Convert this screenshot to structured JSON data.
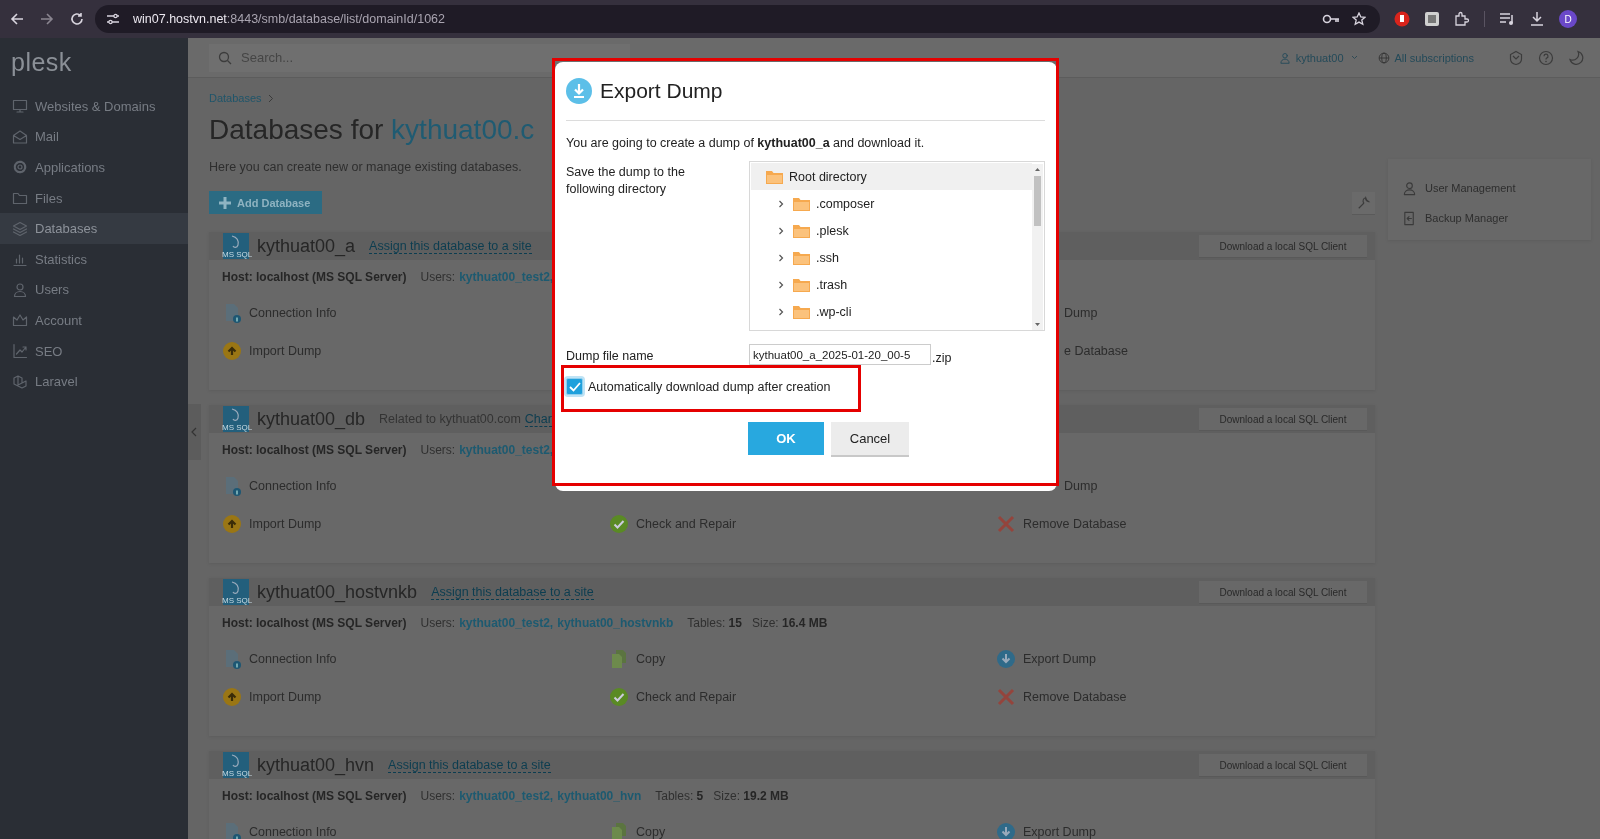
{
  "browser": {
    "url_host": "win07.hostvn.net",
    "url_path": ":8443/smb/database/list/domainId/1062",
    "profile_initial": "D"
  },
  "sidebar": {
    "logo": "plesk",
    "items": [
      {
        "label": "Websites & Domains",
        "selected": false
      },
      {
        "label": "Mail",
        "selected": false
      },
      {
        "label": "Applications",
        "selected": false
      },
      {
        "label": "Files",
        "selected": false
      },
      {
        "label": "Databases",
        "selected": true
      },
      {
        "label": "Statistics",
        "selected": false
      },
      {
        "label": "Users",
        "selected": false
      },
      {
        "label": "Account",
        "selected": false
      },
      {
        "label": "SEO",
        "selected": false
      },
      {
        "label": "Laravel",
        "selected": false
      }
    ]
  },
  "header": {
    "search_placeholder": "Search...",
    "user": "kythuat00",
    "subscriptions": "All subscriptions"
  },
  "breadcrumb": [
    "Databases"
  ],
  "page_title": {
    "text": "Databases for ",
    "link": "kythuat00.c"
  },
  "description": "Here you can create new or manage existing databases.",
  "add_button": "Add Database",
  "databases": [
    {
      "name": "kythuat00_a",
      "badge": "MS SQL",
      "link": "Assign this database to a site",
      "client_button": "Download a local SQL Client",
      "info": {
        "host": "Host: localhost (MS SQL Server)",
        "users_label": "Users:",
        "users": [
          "kythuat00_test2,"
        ]
      },
      "actions": [
        [
          {
            "label": "Connection Info",
            "kind": "full"
          },
          {
            "kind": "covered"
          },
          {
            "label": "Dump",
            "kind": "clipped"
          }
        ],
        [
          {
            "label": "Import Dump",
            "kind": "full"
          },
          {
            "kind": "covered"
          },
          {
            "label": "e Database",
            "kind": "clipped"
          }
        ]
      ]
    },
    {
      "name": "kythuat00_db",
      "badge": "MS SQL",
      "note": "Related to kythuat00.com",
      "link": "Char",
      "client_button": "Download a local SQL Client",
      "info": {
        "host": "Host: localhost (MS SQL Server)",
        "users_label": "Users:",
        "users": [
          "kythuat00_test2,"
        ]
      },
      "actions": [
        [
          {
            "label": "Connection Info",
            "kind": "full"
          },
          {
            "kind": "covered"
          },
          {
            "label": "Dump",
            "kind": "clipped"
          }
        ],
        [
          {
            "label": "Import Dump",
            "kind": "full"
          },
          {
            "label": "Check and Repair",
            "kind": "full"
          },
          {
            "label": "Remove Database",
            "kind": "full"
          }
        ]
      ]
    },
    {
      "name": "kythuat00_hostvnkb",
      "badge": "MS SQL",
      "link": "Assign this database to a site",
      "client_button": "Download a local SQL Client",
      "info": {
        "host": "Host: localhost (MS SQL Server)",
        "users_label": "Users:",
        "users": [
          "kythuat00_test2,",
          "kythuat00_hostvnkb"
        ],
        "tables": "Tables: **15**",
        "size": "Size: **16.4 MB**"
      },
      "actions": [
        [
          {
            "label": "Connection Info",
            "kind": "full"
          },
          {
            "label": "Copy",
            "kind": "full"
          },
          {
            "label": "Export Dump",
            "kind": "full"
          }
        ],
        [
          {
            "label": "Import Dump",
            "kind": "full"
          },
          {
            "label": "Check and Repair",
            "kind": "full"
          },
          {
            "label": "Remove Database",
            "kind": "full"
          }
        ]
      ]
    },
    {
      "name": "kythuat00_hvn",
      "badge": "MS SQL",
      "link": "Assign this database to a site",
      "client_button": "Download a local SQL Client",
      "info": {
        "host": "Host: localhost (MS SQL Server)",
        "users_label": "Users:",
        "users": [
          "kythuat00_test2,",
          "kythuat00_hvn"
        ],
        "tables": "Tables: **5**",
        "size": "Size: **19.2 MB**"
      },
      "actions": [
        [
          {
            "label": "Connection Info",
            "kind": "full"
          },
          {
            "label": "Copy",
            "kind": "full"
          },
          {
            "label": "Export Dump",
            "kind": "full"
          }
        ]
      ]
    }
  ],
  "side_panel": [
    {
      "label": "User Management"
    },
    {
      "label": "Backup Manager"
    }
  ],
  "dialog": {
    "title": "Export Dump",
    "message": "You are going to create a dump of **kythuat00_a** and download it.",
    "directory_label": "Save the dump to the following directory",
    "tree": {
      "label": "Root directory",
      "selected": true,
      "children": [
        {
          "label": ".composer",
          "selected": false,
          "expanded": false
        },
        {
          "label": ".plesk",
          "selected": false,
          "expanded": false
        },
        {
          "label": ".ssh",
          "selected": false,
          "expanded": false
        },
        {
          "label": ".trash",
          "selected": false,
          "expanded": false
        },
        {
          "label": ".wp-cli",
          "selected": false,
          "expanded": false
        }
      ]
    },
    "file_label": "Dump file name",
    "file_name": "kythuat00_a_2025-01-20_00-5",
    "file_extension": ".zip",
    "auto_download": {
      "label": "Automatically download dump after creation",
      "checked": true
    },
    "buttons": [
      {
        "label": "OK",
        "kind": "primary"
      },
      {
        "label": "Cancel",
        "kind": "secondary"
      }
    ]
  }
}
